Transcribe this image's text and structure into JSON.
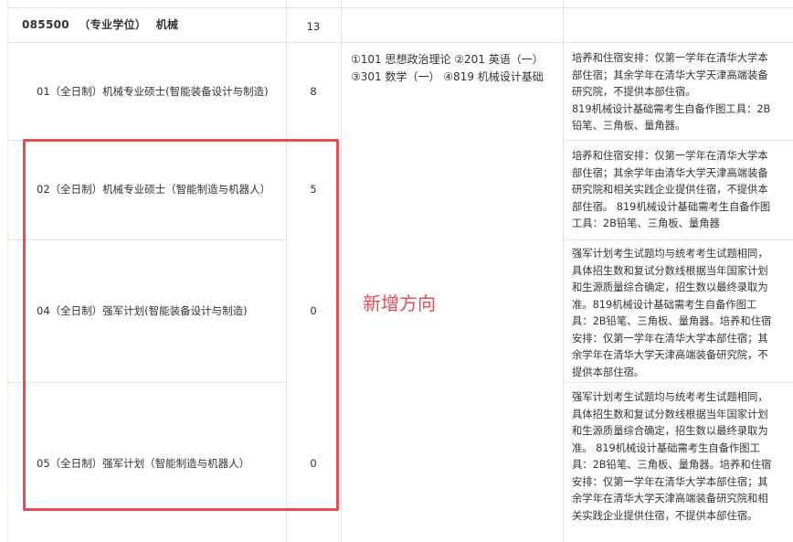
{
  "major": {
    "code": "085500",
    "type": "（专业学位）",
    "name": "机械",
    "count": "13"
  },
  "exam_subjects": [
    "①101 思想政治理论 ②201 英语（一）",
    "③301 数学（一） ④819 机械设计基础"
  ],
  "directions": [
    {
      "name": "01（全日制）机械专业硕士(智能装备设计与制造)",
      "count": "8",
      "note_lines": [
        "培养和住宿安排：仅第一学年在清华大学本",
        "部住宿；其余学年在清华大学天津高端装备",
        "研究院，不提供本部住宿。",
        "819机械设计基础需考生自备作图工具：2B",
        "铅笔、三角板、量角器。"
      ]
    },
    {
      "name": "02（全日制）机械专业硕士（智能制造与机器人）",
      "count": "5",
      "note_lines": [
        "培养和住宿安排：仅第一学年在清华大学本",
        "部住宿；其余学年由清华大学天津高端装备",
        "研究院和相关实践企业提供住宿，不提供本",
        "部住宿。 819机械设计基础需考生自备作图",
        "工具：2B铅笔、三角板、量角器"
      ]
    },
    {
      "name": "04（全日制）强军计划(智能装备设计与制造)",
      "count": "0",
      "note_lines": [
        "强军计划考生试题均与统考考生试题相同，",
        "具体招生数和复试分数线根据当年国家计划",
        "和生源质量综合确定，招生数以最终录取为",
        "准。819机械设计基础需考生自备作图工",
        "具：2B铅笔、三角板、量角器。培养和住宿",
        "安排：仅第一学年在清华大学本部住宿；其",
        "余学年在清华大学天津高端装备研究院，不",
        "提供本部住宿。"
      ]
    },
    {
      "name": "05（全日制）强军计划（智能制造与机器人）",
      "count": "0",
      "note_lines": [
        "强军计划考生试题均与统考考生试题相同，",
        "具体招生数和复试分数线根据当年国家计划",
        "和生源质量综合确定，招生数以最终录取为",
        "准。 819机械设计基础需考生自备作图工",
        "具：2B铅笔、三角板、量角器。培养和住宿",
        "安排：仅第一学年在清华大学本部住宿；其",
        "余学年在清华大学天津高端装备研究院和相",
        "关实践企业提供住宿，不提供本部住宿。"
      ]
    }
  ],
  "annotation": "新增方向",
  "colors": {
    "border": "#e1e4ea",
    "highlight": "#ea4b55",
    "text": "#333333"
  }
}
